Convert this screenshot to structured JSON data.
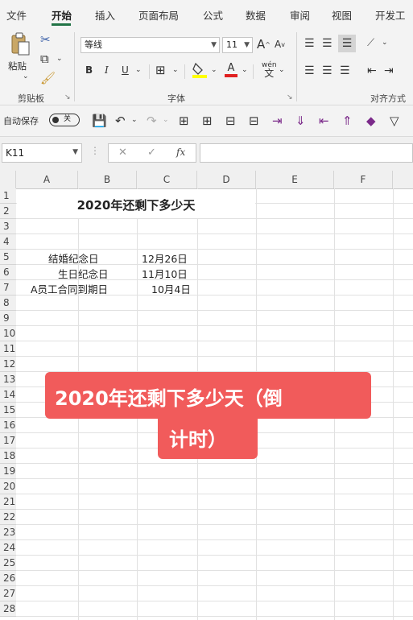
{
  "menu": {
    "tabs": [
      "文件",
      "开始",
      "插入",
      "页面布局",
      "公式",
      "数据",
      "审阅",
      "视图",
      "开发工"
    ],
    "active_index": 1
  },
  "ribbon": {
    "clipboard": {
      "paste_label": "粘贴",
      "group_label": "剪贴板"
    },
    "font": {
      "font_name": "等线",
      "font_size": "11",
      "grow_label": "A",
      "shrink_label": "A",
      "bold_label": "B",
      "italic_label": "I",
      "underline_label": "U",
      "font_color_label": "A",
      "phonetic_label": "wén",
      "group_label": "字体"
    },
    "alignment": {
      "group_label": "对齐方式"
    },
    "colors": {
      "accent": "#217346",
      "highlight": "#ffff00",
      "font_red": "#e02020"
    }
  },
  "quick_access": {
    "autosave_label": "自动保存",
    "autosave_state": "关"
  },
  "formula_bar": {
    "name_box": "K11",
    "cancel_icon": "✕",
    "enter_icon": "✓",
    "fx_label": "fx",
    "content": ""
  },
  "sheet": {
    "columns": [
      "A",
      "B",
      "C",
      "D",
      "E",
      "F"
    ],
    "rows": [
      "1",
      "2",
      "3",
      "4",
      "5",
      "6",
      "7",
      "8",
      "9",
      "10",
      "11",
      "12",
      "13",
      "14",
      "15",
      "16",
      "17",
      "18",
      "19",
      "20",
      "21",
      "22",
      "23",
      "24",
      "25",
      "26",
      "27",
      "28"
    ],
    "title": "2020年还剩下多少天",
    "entries": [
      {
        "label": "结婚纪念日",
        "date": "12月26日"
      },
      {
        "label": "生日纪念日",
        "date": "11月10日"
      },
      {
        "label": "A员工合同到期日",
        "date": "10月4日"
      }
    ]
  },
  "overlay": {
    "line1": "2020年还剩下多少天（倒",
    "line2": "计时）",
    "color": "#f15b5b"
  }
}
